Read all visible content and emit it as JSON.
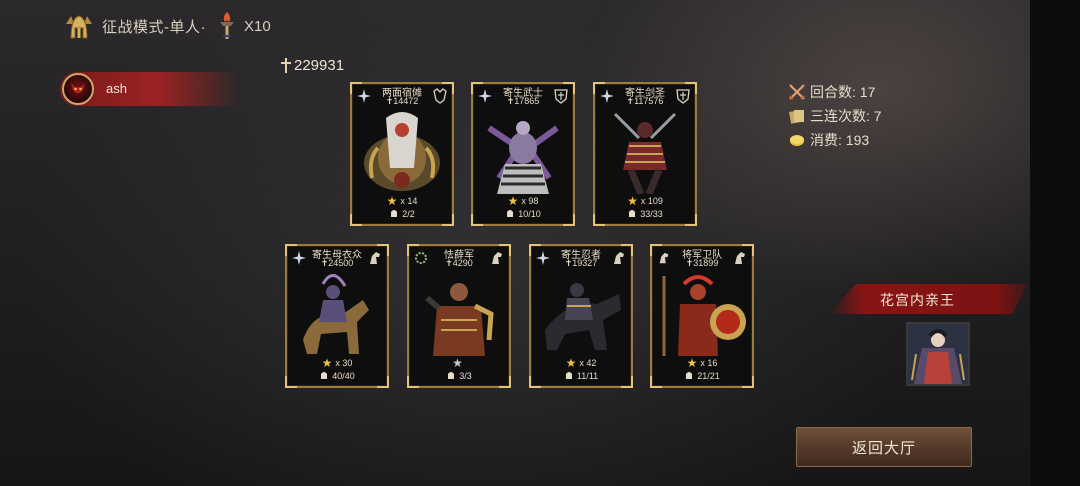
{
  "header": {
    "mode": "征战模式-单人·",
    "multiplier": "X10",
    "helm_icon": "helmet-icon",
    "torch_icon": "torch-icon"
  },
  "player": {
    "name": "ash",
    "avatar_icon": "demon-avatar-icon"
  },
  "total_power": "229931",
  "cards_row1": [
    {
      "name": "两面宿傩",
      "power": "14472",
      "stars": "x 14",
      "troops": "2/2",
      "left_icon": "compass-icon",
      "right_icon": "crest-icon",
      "palette": "#8b6a3a"
    },
    {
      "name": "寄生武士",
      "power": "17865",
      "stars": "x 98",
      "troops": "10/10",
      "left_icon": "compass-icon",
      "right_icon": "shield-icon",
      "palette": "#6c5a7a"
    },
    {
      "name": "寄生剑圣",
      "power": "117576",
      "stars": "x 109",
      "troops": "33/33",
      "left_icon": "compass-icon",
      "right_icon": "shield-icon",
      "palette": "#7a2a2a"
    }
  ],
  "cards_row2": [
    {
      "name": "寄生母衣众",
      "power": "24500",
      "stars": "x 30",
      "troops": "40/40",
      "left_icon": "compass-icon",
      "right_icon": "horse-icon",
      "palette": "#5a4e7a"
    },
    {
      "name": "怯薛军",
      "power": "4290",
      "stars": "",
      "troops": "3/3",
      "left_icon": "wreath-icon",
      "right_icon": "horse-icon",
      "palette": "#7a3a22",
      "star_grey": true
    },
    {
      "name": "寄生忍者",
      "power": "19327",
      "stars": "x 42",
      "troops": "11/11",
      "left_icon": "compass-icon",
      "right_icon": "horse-icon",
      "palette": "#3a3a44"
    },
    {
      "name": "将军卫队",
      "power": "31899",
      "stars": "x 16",
      "troops": "21/21",
      "left_icon": "horse-icon",
      "right_icon": "horse-icon",
      "palette": "#8a2a1a"
    }
  ],
  "stats": {
    "rounds": "回合数: 17",
    "triple": "三连次数: 7",
    "cost": "消费: 193"
  },
  "prince": {
    "title": "花宫内亲王"
  },
  "buttons": {
    "return": "返回大厅"
  },
  "colors": {
    "gold": "#f0c23b",
    "red_banner": "#8a1414",
    "card_border": "#9c7b3e"
  }
}
